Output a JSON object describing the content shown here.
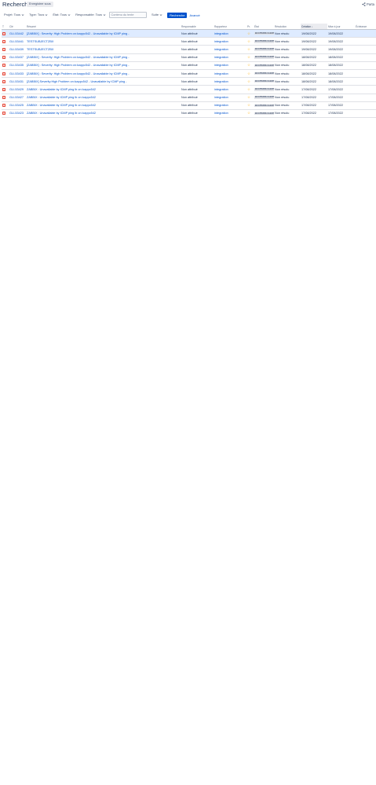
{
  "header": {
    "title": "Recherche",
    "save_label": "Enregistrer sous",
    "share_label": "Parta"
  },
  "filters": {
    "project": "Projet: Tous",
    "type": "Type: Tous",
    "state": "État: Tous",
    "assignee": "Responsable: Tous",
    "text_placeholder": "Contenu du texte",
    "more": "Suite",
    "search_button": "Recherche",
    "advanced": "Avancé"
  },
  "colors": {
    "accent": "#0052cc",
    "selected_row": "#deebff",
    "bug_icon": "#e5493a",
    "star": "#ffab00"
  },
  "table": {
    "headers": {
      "type": "T",
      "key": "Clé",
      "summary": "Résumé",
      "assignee": "Responsable",
      "reporter": "Rapporteur",
      "priority": "Pr.",
      "state": "État",
      "resolution": "Résolution",
      "created": "Création",
      "updated": "Mise à jour",
      "due": "Échéance"
    },
    "sort_indicator": "↓",
    "rows": [
      {
        "key": "GLI-53442",
        "summary": "[ZABBIX] : Severity: High Problem on:lcappc542 - Unavailable by ICMP ping -",
        "assignee": "Non attribué",
        "reporter": "integration",
        "state": "EN ATTENTE CLIENT",
        "resolution": "Non résolu",
        "created": "19/08/2022",
        "updated": "19/08/2022",
        "selected": true
      },
      {
        "key": "GLI-53441",
        "summary": "TESTSUBJECTZBX",
        "assignee": "Non attribué",
        "reporter": "integration",
        "state": "EN ATTENTE CLIENT",
        "resolution": "Non résolu",
        "created": "19/08/2022",
        "updated": "19/08/2022"
      },
      {
        "key": "GLI-53439",
        "summary": "TESTSUBJECTZBX",
        "assignee": "Non attribué",
        "reporter": "integration",
        "state": "EN ATTENTE CLIENT",
        "resolution": "Non résolu",
        "created": "19/08/2022",
        "updated": "19/08/2022"
      },
      {
        "key": "GLI-53437",
        "summary": "[ZABBIX] : Severity: High Problem on:lcappc542 - Unavailable by ICMP ping -",
        "assignee": "Non attribué",
        "reporter": "integration",
        "state": "EN ATTENTE CLIENT",
        "resolution": "Non résolu",
        "created": "18/08/2022",
        "updated": "18/08/2022"
      },
      {
        "key": "GLI-53435",
        "summary": "[ZABBIX] : Severity: High Problem on:lcappc542 - Unavailable by ICMP ping -",
        "assignee": "Non attribué",
        "reporter": "integration",
        "state": "EN ATTENTE CLIENT",
        "resolution": "Non résolu",
        "created": "18/08/2022",
        "updated": "18/08/2022"
      },
      {
        "key": "GLI-53433",
        "summary": "[ZABBIX] : Severity: High Problem on:lcappc542 - Unavailable by ICMP ping -",
        "assignee": "Non attribué",
        "reporter": "integration",
        "state": "EN ATTENTE CLIENT",
        "resolution": "Non résolu",
        "created": "18/08/2022",
        "updated": "18/08/2022"
      },
      {
        "key": "GLI-53431",
        "summary": "[ZABBIX] Severity:High Problem on:lcappc542 - Unavailable by ICMP ping -",
        "assignee": "Non attribué",
        "reporter": "integration",
        "state": "EN ATTENTE CLIENT",
        "resolution": "Non résolu",
        "created": "18/08/2022",
        "updated": "18/08/2022"
      },
      {
        "key": "GLI-53429",
        "summary": "ZABBIX : Unavailable by ICMP ping lb on lcappc542",
        "assignee": "Non attribué",
        "reporter": "integration",
        "state": "EN ATTENTE CLIENT",
        "resolution": "Non résolu",
        "created": "17/08/2022",
        "updated": "17/08/2022"
      },
      {
        "key": "GLI-53427",
        "summary": "ZABBIX : Unavailable by ICMP ping lb on lcappc542",
        "assignee": "Non attribué",
        "reporter": "integration",
        "state": "EN ATTENTE CLIENT",
        "resolution": "Non résolu",
        "created": "17/08/2022",
        "updated": "17/08/2022"
      },
      {
        "key": "GLI-53425",
        "summary": "ZABBIX : Unavailable by ICMP ping lb on lcappc542",
        "assignee": "Non attribué",
        "reporter": "integration",
        "state": "EN ATTENTE CLIENT",
        "resolution": "Non résolu",
        "created": "17/08/2022",
        "updated": "17/08/2022"
      },
      {
        "key": "GLI-53423",
        "summary": "ZABBIX : Unavailable by ICMP ping lb on lcappc542",
        "assignee": "Non attribué",
        "reporter": "integration",
        "state": "EN ATTENTE CLIENT",
        "resolution": "Non résolu",
        "created": "17/08/2022",
        "updated": "17/08/2022"
      }
    ]
  }
}
